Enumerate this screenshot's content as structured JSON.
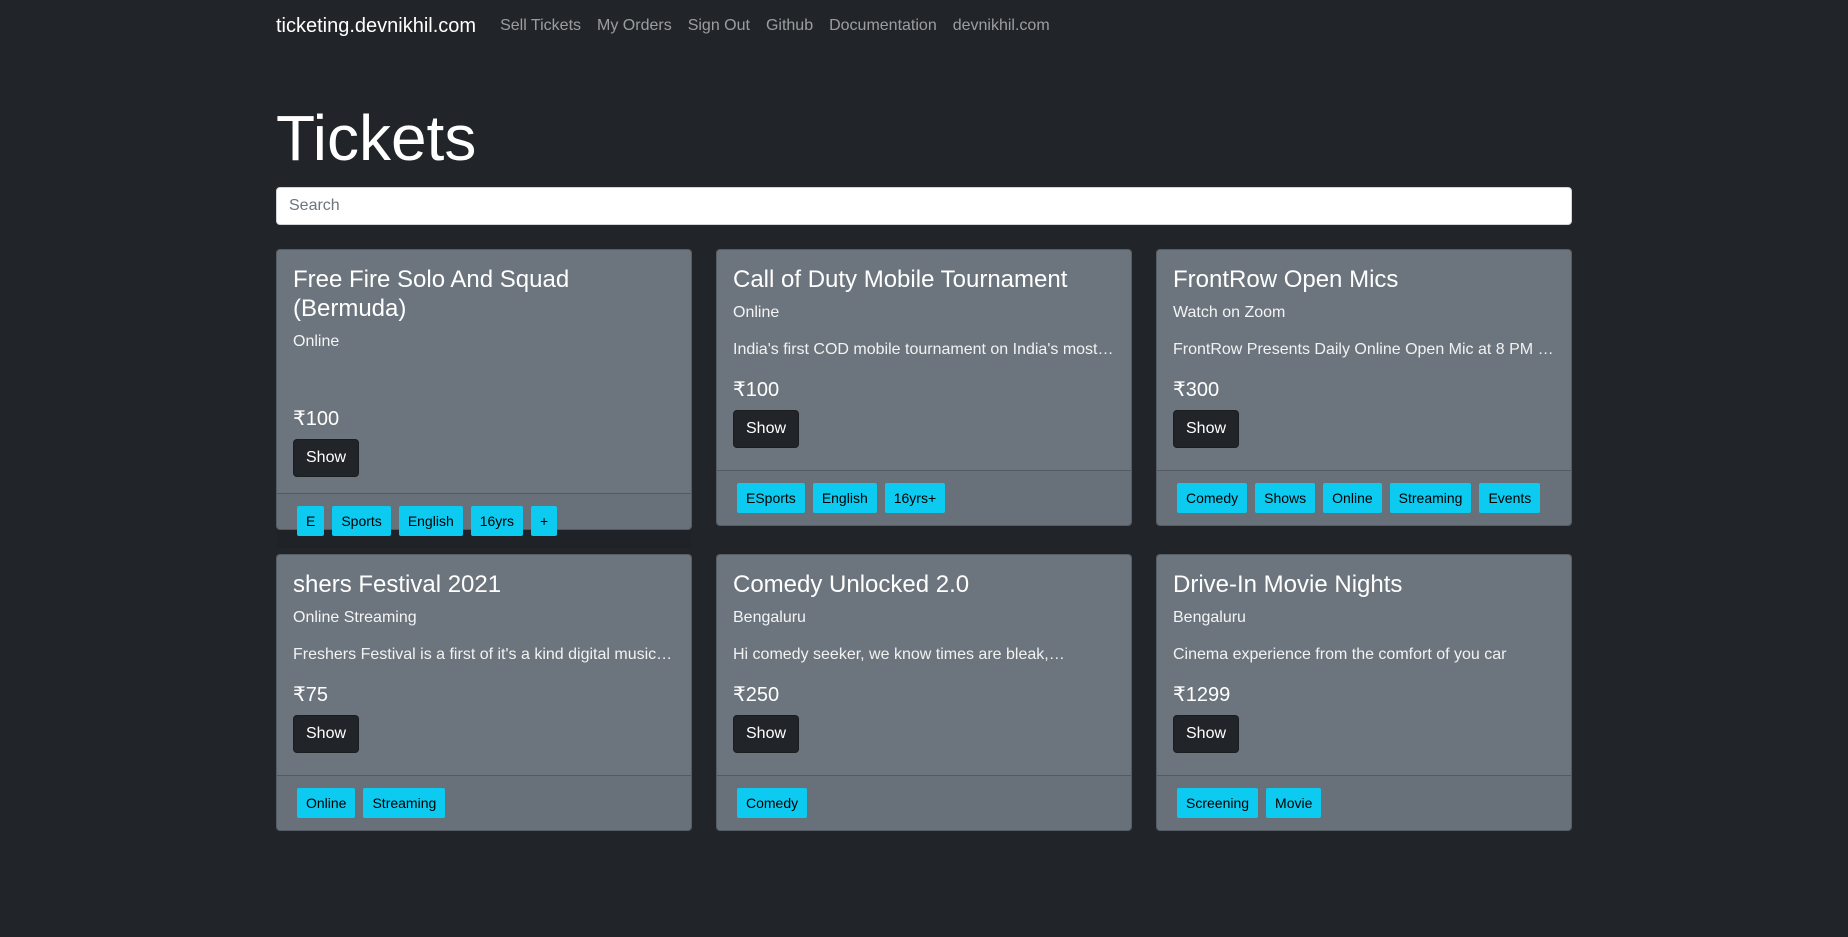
{
  "navbar": {
    "brand": "ticketing.devnikhil.com",
    "links": [
      "Sell Tickets",
      "My Orders",
      "Sign Out",
      "Github",
      "Documentation",
      "devnikhil.com"
    ]
  },
  "page": {
    "title": "Tickets"
  },
  "search": {
    "placeholder": "Search",
    "value": ""
  },
  "show_label": "Show",
  "tickets": [
    {
      "title": "Free Fire Solo And Squad (Bermuda)",
      "location": "Online",
      "description": "",
      "price": "₹100",
      "tags": [
        "E",
        "Sports",
        "English",
        "16yrs",
        "+"
      ]
    },
    {
      "title": "Call of Duty Mobile Tournament",
      "location": "Online",
      "description": "India's first COD mobile tournament on India's most…",
      "price": "₹100",
      "tags": [
        "ESports",
        "English",
        "16yrs+"
      ]
    },
    {
      "title": "FrontRow Open Mics",
      "location": "Watch on Zoom",
      "description": "FrontRow Presents Daily Online Open Mic at 8 PM …",
      "price": "₹300",
      "tags": [
        "Comedy",
        "Shows",
        "Online",
        "Streaming",
        "Events"
      ]
    },
    {
      "title": "shers Festival 2021",
      "location": "Online Streaming",
      "description": "Freshers Festival is a first of it's a kind digital music…",
      "price": "₹75",
      "tags": [
        "Online",
        "Streaming"
      ]
    },
    {
      "title": "Comedy Unlocked 2.0",
      "location": "Bengaluru",
      "description": "Hi comedy seeker, we know times are bleak,…",
      "price": "₹250",
      "tags": [
        "Comedy"
      ]
    },
    {
      "title": "Drive-In Movie Nights",
      "location": "Bengaluru",
      "description": "Cinema experience from the comfort of you car",
      "price": "₹1299",
      "tags": [
        "Screening",
        "Movie"
      ]
    }
  ]
}
